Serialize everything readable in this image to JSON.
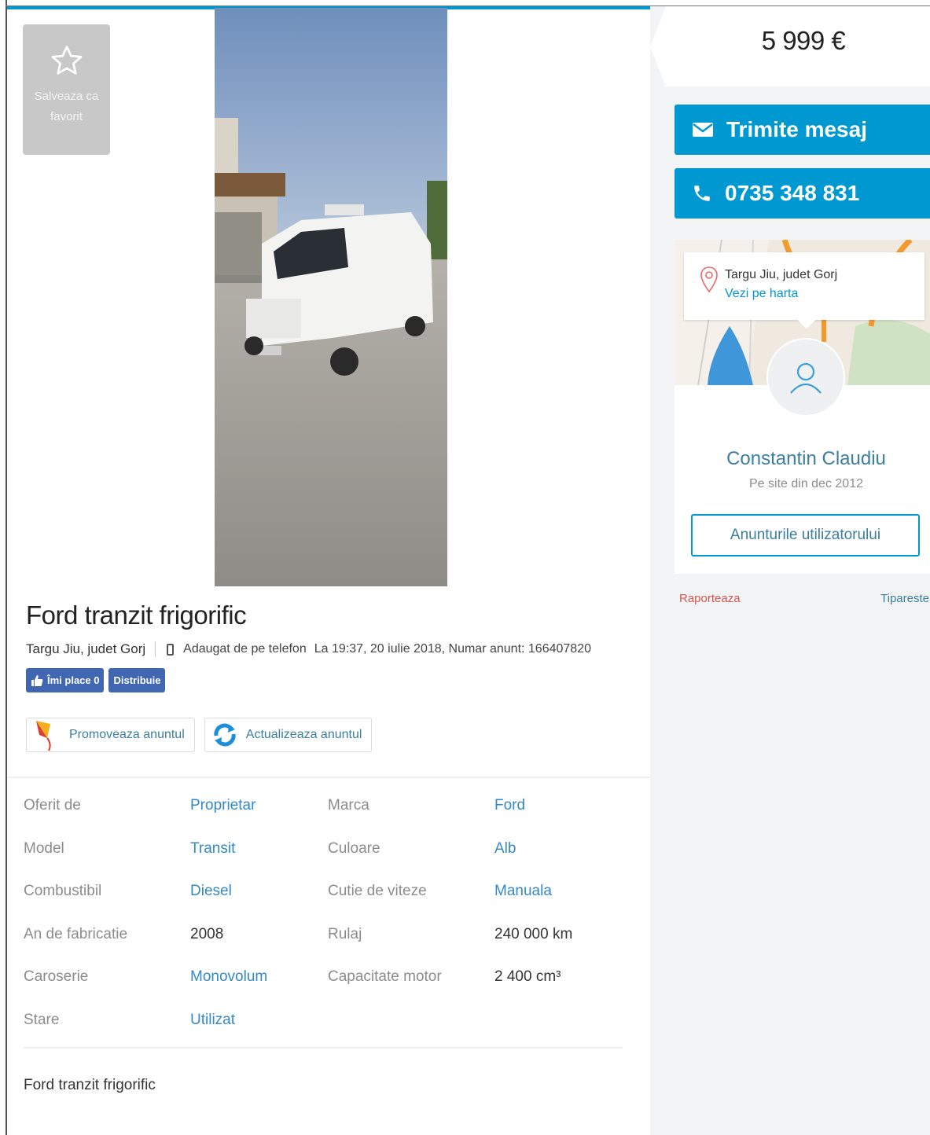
{
  "favorite": {
    "label": "Salveaza ca favorit",
    "icon": "star-icon"
  },
  "listing": {
    "title": "Ford tranzit frigorific",
    "location": "Targu Jiu, judet Gorj",
    "added_from": "Adaugat de pe telefon",
    "added_info": "La 19:37, 20 iulie 2018, Numar anunt: 166407820",
    "description": "Ford tranzit frigorific"
  },
  "social": {
    "like_label": "Îmi place 0",
    "share_label": "Distribuie"
  },
  "actions": {
    "promote_label": "Promoveaza anuntul",
    "refresh_label": "Actualizeaza anuntul"
  },
  "details": [
    {
      "label": "Oferit de",
      "value": "Proprietar",
      "link": true
    },
    {
      "label": "Marca",
      "value": "Ford",
      "link": true
    },
    {
      "label": "Model",
      "value": "Transit",
      "link": true
    },
    {
      "label": "Culoare",
      "value": "Alb",
      "link": true
    },
    {
      "label": "Combustibil",
      "value": "Diesel",
      "link": true
    },
    {
      "label": "Cutie de viteze",
      "value": "Manuala",
      "link": true
    },
    {
      "label": "An de fabricatie",
      "value": "2008",
      "link": false
    },
    {
      "label": "Rulaj",
      "value": "240 000 km",
      "link": false
    },
    {
      "label": "Caroserie",
      "value": "Monovolum",
      "link": true
    },
    {
      "label": "Capacitate motor",
      "value": "2 400 cm³",
      "link": false
    },
    {
      "label": "Stare",
      "value": "Utilizat",
      "link": true
    }
  ],
  "sidebar": {
    "price": "5 999 €",
    "message_label": "Trimite mesaj",
    "phone_label": "0735 348 831",
    "map": {
      "city": "Targu Jiu, judet Gorj",
      "link_label": "Vezi pe harta"
    },
    "seller": {
      "name": "Constantin Claudiu",
      "since": "Pe site din dec 2012",
      "ads_label": "Anunturile utilizatorului"
    },
    "report_label": "Raporteaza",
    "print_label": "Tipareste"
  },
  "colors": {
    "accent": "#0098d0",
    "link": "#3389c9",
    "facebook": "#4267b2",
    "report": "#d9534f"
  }
}
